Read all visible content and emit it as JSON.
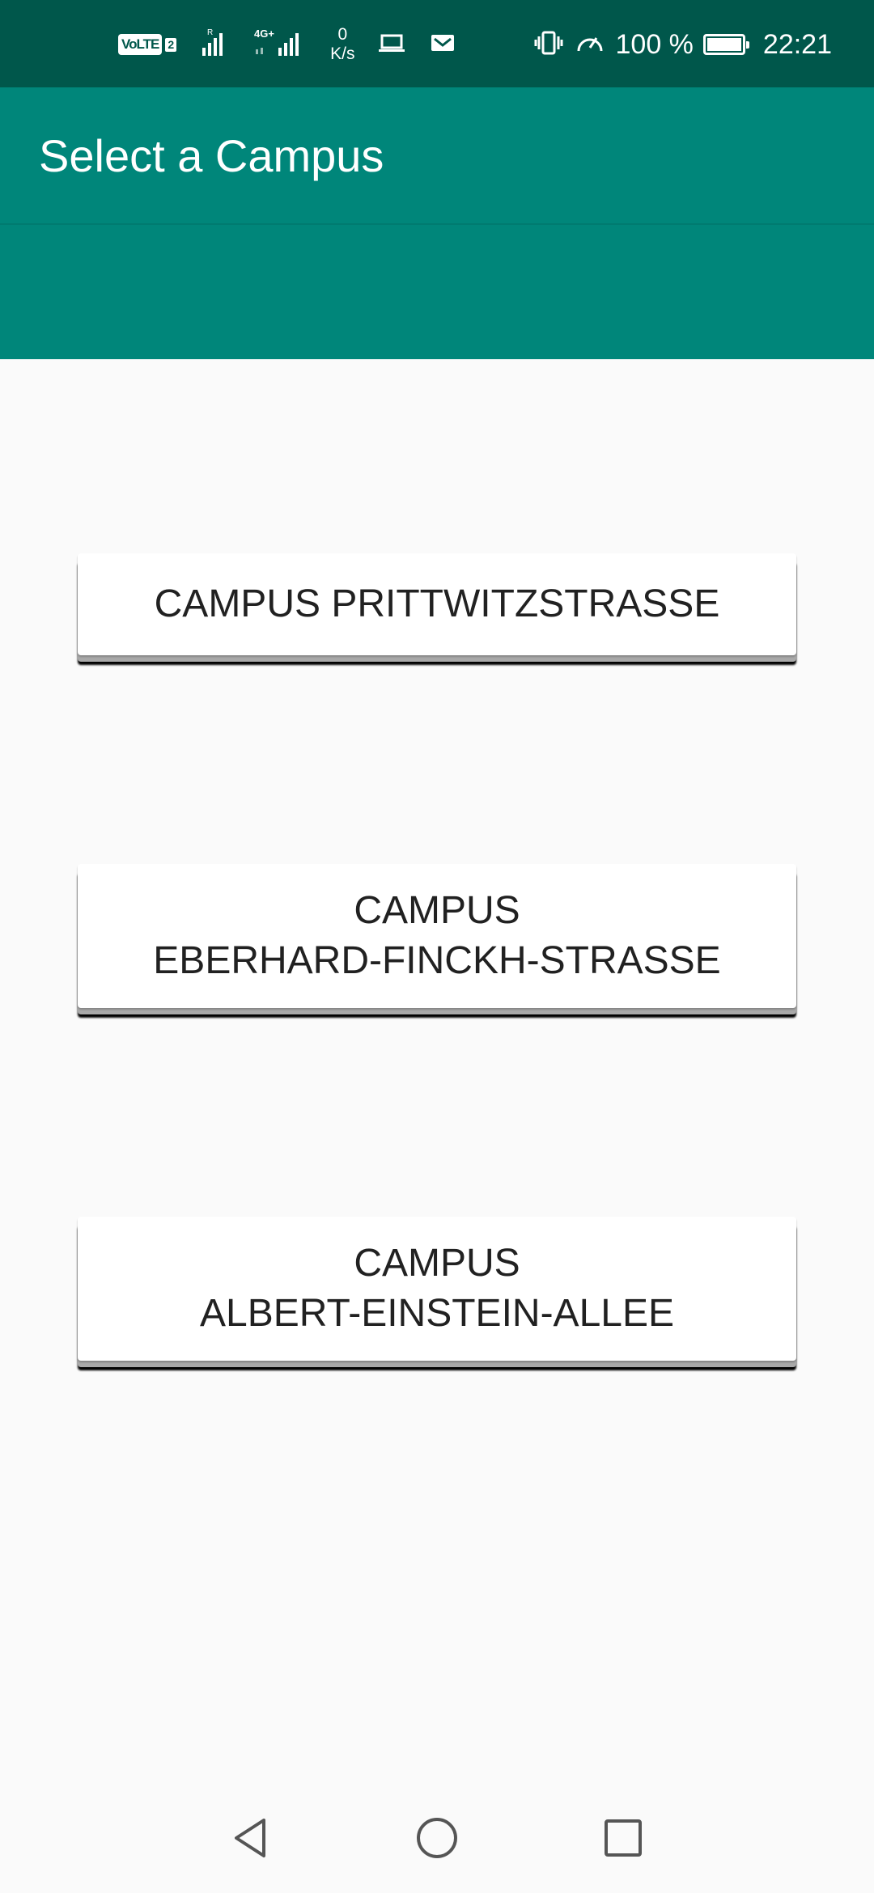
{
  "status_bar": {
    "volte_label": "VoLTE",
    "sim_number": "2",
    "signal_r_label": "R",
    "network_type": "4G+",
    "net_speed_value": "0",
    "net_speed_unit": "K/s",
    "battery_percent": "100 %",
    "time": "22:21",
    "icons": [
      "signal-icon",
      "signal-icon",
      "laptop-icon",
      "mail-icon",
      "vibrate-icon",
      "speed-icon",
      "battery-icon"
    ],
    "color": "#00574b"
  },
  "app_bar": {
    "title": "Select a Campus",
    "color": "#00867a"
  },
  "campuses": [
    {
      "line1": "CAMPUS PRITTWITZSTRASSE",
      "line2": ""
    },
    {
      "line1": "CAMPUS",
      "line2": "EBERHARD-FINCKH-STRASSE"
    },
    {
      "line1": "CAMPUS",
      "line2": "ALBERT-EINSTEIN-ALLEE"
    }
  ],
  "nav_bar": {
    "icons": [
      "back-icon",
      "home-icon",
      "recent-apps-icon"
    ]
  }
}
